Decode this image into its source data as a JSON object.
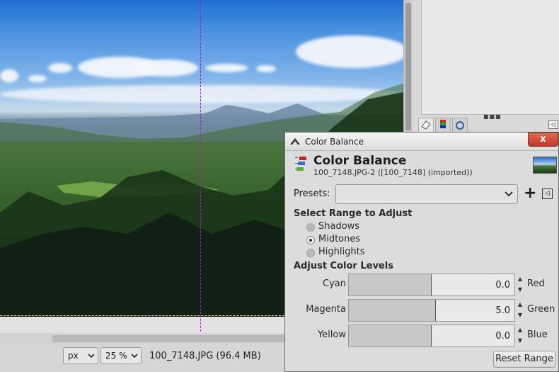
{
  "status_bar": {
    "unit": "px",
    "zoom": "25 %",
    "image_info": "100_7148.JPG (96.4 MB)"
  },
  "dialog": {
    "window_title": "Color Balance",
    "header_title": "Color Balance",
    "header_subtitle": "100_7148.JPG-2 ([100_7148] (imported))",
    "close_label": "x",
    "presets_label": "Presets:",
    "presets_value": "",
    "add_preset_label": "+",
    "range_section": "Select Range to Adjust",
    "ranges": [
      {
        "label": "Shadows",
        "checked": false
      },
      {
        "label": "Midtones",
        "checked": true
      },
      {
        "label": "Highlights",
        "checked": false
      }
    ],
    "levels_section": "Adjust Color Levels",
    "levels": [
      {
        "left": "Cyan",
        "right": "Red",
        "value": "0.0",
        "fraction": 0.5
      },
      {
        "left": "Magenta",
        "right": "Green",
        "value": "5.0",
        "fraction": 0.525
      },
      {
        "left": "Yellow",
        "right": "Blue",
        "value": "0.0",
        "fraction": 0.5
      }
    ],
    "reset_label": "Reset Range"
  },
  "colors": {
    "guide": "#d400d4",
    "close_button": "#c0392b"
  },
  "icons": {
    "title": "color-balance-icon",
    "header": "color-balance-icon",
    "presets_menu": "menu-arrow-icon",
    "dock_menu": "menu-arrow-icon"
  }
}
